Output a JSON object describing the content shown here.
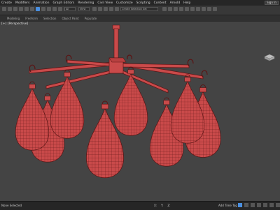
{
  "menu": {
    "items": [
      "Create",
      "Modifiers",
      "Animation",
      "Graph Editors",
      "Rendering",
      "Civil View",
      "Customize",
      "Scripting",
      "Content",
      "Arnold",
      "Help"
    ],
    "workspace_label": "Sign In"
  },
  "toolbar": {
    "selection_filter": "All",
    "view_dropdown": "View",
    "selection_set": "Create Selection Set"
  },
  "ribbon": {
    "tabs": [
      "Modeling",
      "Freeform",
      "Selection",
      "Object Paint",
      "Populate"
    ]
  },
  "viewport": {
    "label": "[+] [Perspective]"
  },
  "statusbar": {
    "selection_info": "None Selected",
    "x_label": "X:",
    "y_label": "Y:",
    "z_label": "Z:",
    "add_time_tag": "Add Time Tag",
    "auto_key": "Auto"
  },
  "colors": {
    "mesh_red": "#c94a4a",
    "wire_dark": "#5a1414",
    "accent_blue": "#4a8fe0",
    "viewport_bg": "#444444"
  }
}
